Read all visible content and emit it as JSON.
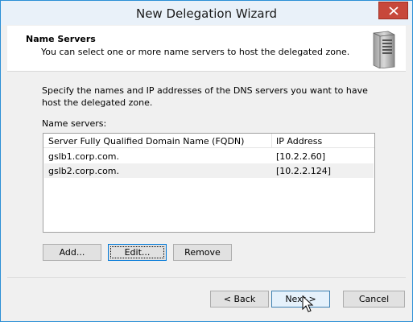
{
  "window": {
    "title": "New Delegation Wizard",
    "close_label": "✕"
  },
  "header": {
    "title": "Name Servers",
    "subtitle": "You can select one or more name servers to host the delegated zone."
  },
  "body": {
    "description": "Specify the names and IP addresses of the DNS servers you want to have host the delegated zone.",
    "list_label": "Name servers:"
  },
  "table": {
    "columns": [
      "Server Fully Qualified Domain Name (FQDN)",
      "IP Address"
    ],
    "rows": [
      [
        "gslb1.corp.com.",
        "[10.2.2.60]"
      ],
      [
        "gslb2.corp.com.",
        "[10.2.2.124]"
      ]
    ]
  },
  "list_buttons": {
    "add": "Add...",
    "edit": "Edit...",
    "remove": "Remove"
  },
  "nav_buttons": {
    "back": "< Back",
    "next": "Next >",
    "cancel": "Cancel"
  },
  "colors": {
    "title_bar": "#e9f1f9",
    "accent": "#0078d7",
    "close": "#c7483b"
  },
  "icons": [
    "close-icon",
    "server-icon",
    "mouse-pointer-icon"
  ]
}
